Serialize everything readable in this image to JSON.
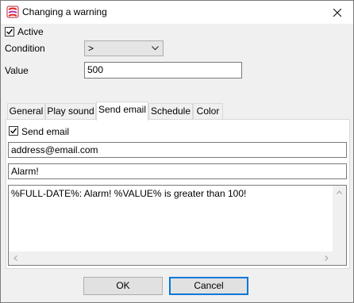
{
  "window": {
    "title": "Changing a warning"
  },
  "active": {
    "label": "Active",
    "checked": true
  },
  "condition": {
    "label": "Condition",
    "value": ">"
  },
  "value_field": {
    "label": "Value",
    "value": "500"
  },
  "tabs": [
    {
      "label": "General",
      "active": false
    },
    {
      "label": "Play sound",
      "active": false
    },
    {
      "label": "Send email",
      "active": true
    },
    {
      "label": "Schedule",
      "active": false
    },
    {
      "label": "Color",
      "active": false
    }
  ],
  "send_email": {
    "checkbox_label": "Send email",
    "checked": true,
    "address": "address@email.com",
    "subject": "Alarm!",
    "body": "%FULL-DATE%: Alarm! %VALUE% is greater than 100!"
  },
  "buttons": {
    "ok": "OK",
    "cancel": "Cancel"
  },
  "icons": {
    "app": "app-icon",
    "close": "close-icon"
  },
  "colors": {
    "default_button_border": "#0078d7",
    "panel_bg": "#ffffff",
    "dialog_bg": "#f0f0f0"
  }
}
